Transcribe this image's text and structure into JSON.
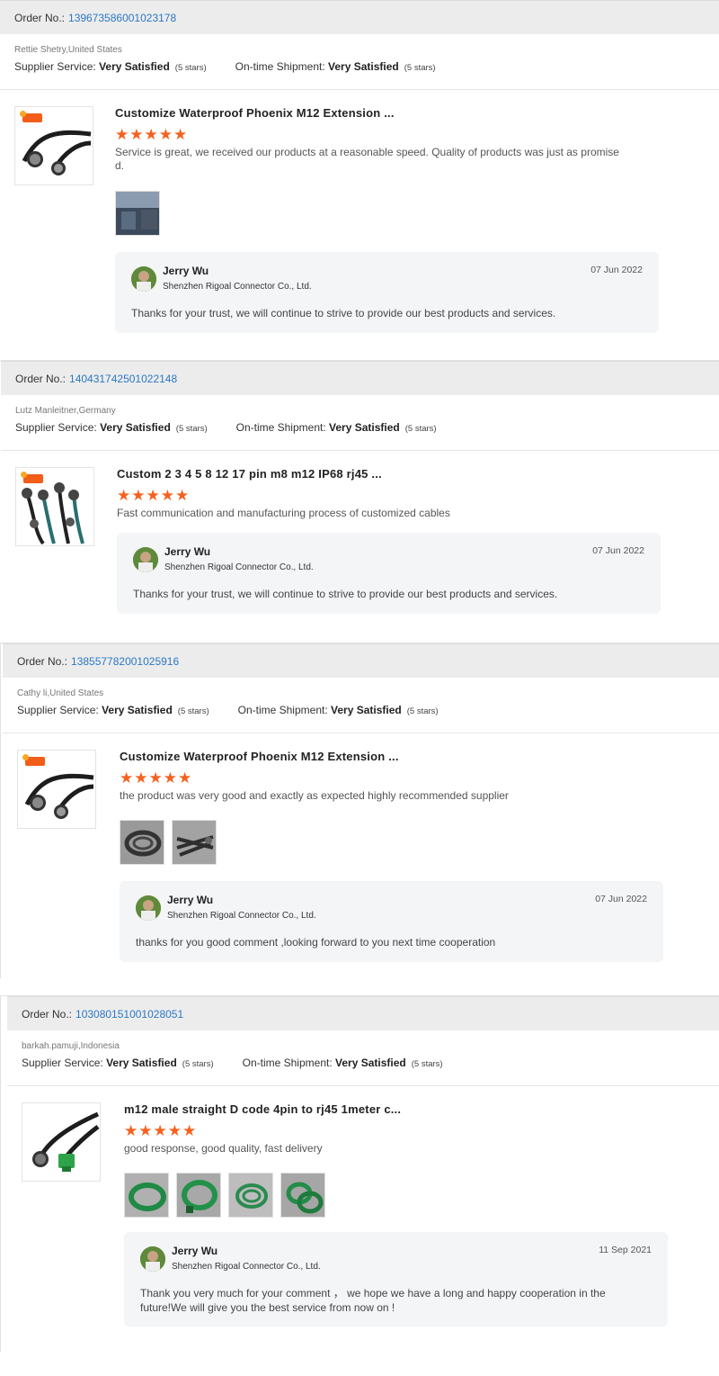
{
  "reviews": [
    {
      "order_label": "Order No.:",
      "order_no": "139673586001023178",
      "buyer": "Rettie Shetry,United States",
      "supplier_label": "Supplier Service:",
      "supplier_value": "Very Satisfied",
      "supplier_stars": "(5 stars)",
      "shipment_label": "On-time Shipment:",
      "shipment_value": "Very Satisfied",
      "shipment_stars": "(5 stars)",
      "product_title": "Customize Waterproof Phoenix M12 Extension ...",
      "rating": 5,
      "comment": "Service is great, we received our products at a reasonable speed. Quality of products was just as promised.",
      "photo_count": 1,
      "reply": {
        "name": "Jerry Wu",
        "company": "Shenzhen Rigoal Connector Co., Ltd.",
        "date": "07 Jun 2022",
        "text": "Thanks for your trust, we will continue to strive to provide our best products and services."
      }
    },
    {
      "order_label": "Order No.:",
      "order_no": "140431742501022148",
      "buyer": "Lutz Manleitner,Germany",
      "supplier_label": "Supplier Service:",
      "supplier_value": "Very Satisfied",
      "supplier_stars": "(5 stars)",
      "shipment_label": "On-time Shipment:",
      "shipment_value": "Very Satisfied",
      "shipment_stars": "(5 stars)",
      "product_title": "Custom 2 3 4 5 8 12 17 pin m8 m12 IP68 rj45 ...",
      "rating": 5,
      "comment": "Fast communication and manufacturing process of customized cables",
      "photo_count": 0,
      "reply": {
        "name": "Jerry Wu",
        "company": "Shenzhen Rigoal Connector Co., Ltd.",
        "date": "07 Jun 2022",
        "text": "Thanks for your trust, we will continue to strive to provide our best products and services."
      }
    },
    {
      "order_label": "Order No.:",
      "order_no": "138557782001025916",
      "buyer": "Cathy li,United States",
      "supplier_label": "Supplier Service:",
      "supplier_value": "Very Satisfied",
      "supplier_stars": "(5 stars)",
      "shipment_label": "On-time Shipment:",
      "shipment_value": "Very Satisfied",
      "shipment_stars": "(5 stars)",
      "product_title": "Customize Waterproof Phoenix M12 Extension ...",
      "rating": 5,
      "comment": "the product was very good and exactly as expected highly recommended supplier",
      "photo_count": 2,
      "reply": {
        "name": "Jerry Wu",
        "company": "Shenzhen Rigoal Connector Co., Ltd.",
        "date": "07 Jun 2022",
        "text": "thanks for you good comment ,looking forward to you next time cooperation"
      }
    },
    {
      "order_label": "Order No.:",
      "order_no": "103080151001028051",
      "buyer": "barkah.pamuji,Indonesia",
      "supplier_label": "Supplier Service:",
      "supplier_value": "Very Satisfied",
      "supplier_stars": "(5 stars)",
      "shipment_label": "On-time Shipment:",
      "shipment_value": "Very Satisfied",
      "shipment_stars": "(5 stars)",
      "product_title": "m12 male straight D code 4pin to rj45 1meter c...",
      "rating": 5,
      "comment": "good response, good quality, fast delivery",
      "photo_count": 4,
      "reply": {
        "name": "Jerry Wu",
        "company": "Shenzhen Rigoal Connector Co., Ltd.",
        "date": "11 Sep 2021",
        "text": "Thank you very much for your comment ， we hope we have a long and happy cooperation in the future!We will give you the best service from now on !"
      }
    }
  ],
  "colors": {
    "accent_link": "#2b78c5",
    "star": "#f5611f",
    "header_bg": "#ececec",
    "reply_bg": "#f4f5f7"
  },
  "icons": {
    "star": "star-icon",
    "avatar": "avatar",
    "hot_badge": "hot-badge-icon"
  }
}
